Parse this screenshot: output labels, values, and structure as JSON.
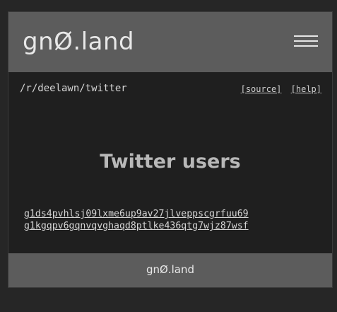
{
  "header": {
    "logo_text": "gnØ.land",
    "menu_icon": "hamburger-menu-icon"
  },
  "breadcrumb": {
    "path": "/r/deelawn/twitter",
    "source_label": "[source]",
    "help_label": "[help]"
  },
  "main": {
    "title": "Twitter users",
    "users": [
      "g1ds4pvhlsj09lxme6up9av27jlveppscgrfuu69",
      "g1kgqpv6gqnvqvghaqd8ptlke436qtg7wjz87wsf"
    ]
  },
  "footer": {
    "logo_text": "gnØ.land"
  }
}
